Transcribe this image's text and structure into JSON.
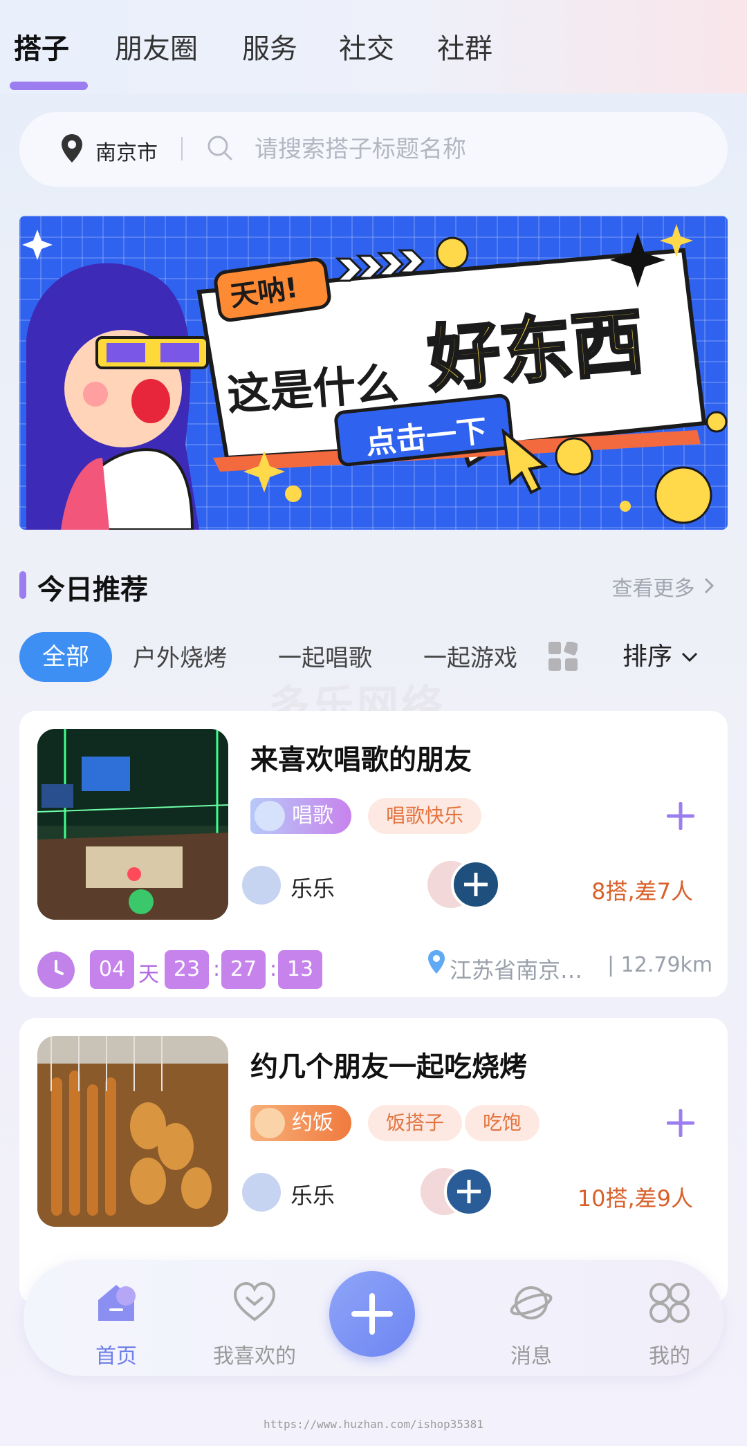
{
  "tabs": [
    "搭子",
    "朋友圈",
    "服务",
    "社交",
    "社群"
  ],
  "search": {
    "city": "南京市",
    "placeholder": "请搜索搭子标题名称"
  },
  "banner": {
    "exclaim": "天呐!",
    "line1": "这是什么",
    "line2": "好东西",
    "button": "点击一下"
  },
  "section": {
    "title": "今日推荐",
    "more": "查看更多"
  },
  "filters": {
    "active": "全部",
    "items": [
      "户外烧烤",
      "一起唱歌",
      "一起游戏"
    ],
    "sort": "排序"
  },
  "watermark": "多乐网络",
  "cards": [
    {
      "title": "来喜欢唱歌的朋友",
      "category": "唱歌",
      "tags": [
        "唱歌快乐"
      ],
      "user": "乐乐",
      "count": "8搭,差7人",
      "countdown": {
        "days": "04",
        "day_unit": "天",
        "hours": "23",
        "minutes": "27",
        "seconds": "13"
      },
      "location": "江苏省南京…",
      "distance": "| 12.79km"
    },
    {
      "title": "约几个朋友一起吃烧烤",
      "category": "约饭",
      "tags": [
        "饭搭子",
        "吃饱"
      ],
      "user": "乐乐",
      "count": "10搭,差9人"
    }
  ],
  "nav": {
    "home": "首页",
    "likes": "我喜欢的",
    "messages": "消息",
    "mine": "我的"
  },
  "footer": "https://www.huzhan.com/ishop35381",
  "colors": {
    "accent": "#9b7df0",
    "blue": "#3d8ff3",
    "orange": "#d8612a",
    "timer": "#c783ec"
  }
}
